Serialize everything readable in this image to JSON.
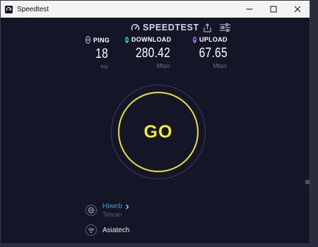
{
  "window": {
    "title": "Speedtest",
    "controls": [
      "minimize-icon",
      "maximize-icon",
      "close-icon"
    ]
  },
  "header": {
    "brand": "SPEEDTEST",
    "icons": [
      "share-icon",
      "settings-sliders-icon"
    ]
  },
  "metrics": {
    "ping": {
      "label": "PING",
      "value": "18",
      "unit": "ms",
      "icon": "ping-icon",
      "color": "#c9c9d6"
    },
    "download": {
      "label": "DOWNLOAD",
      "value": "280.42",
      "unit": "Mbps",
      "icon": "download-icon",
      "color": "#26d3c2"
    },
    "upload": {
      "label": "UPLOAD",
      "value": "67.65",
      "unit": "Mbps",
      "icon": "upload-icon",
      "color": "#b07cf0"
    }
  },
  "go_button": {
    "label": "GO",
    "color": "#f3ea3a"
  },
  "server": {
    "isp": "Hiweb",
    "location": "Tehran",
    "host": "Asiatech",
    "icons": [
      "globe-icon",
      "wifi-icon",
      "chevron-right-icon"
    ]
  },
  "colors": {
    "background": "#141526",
    "accent_link": "#3c9cdb",
    "titlebar": "#f3f3f3"
  }
}
